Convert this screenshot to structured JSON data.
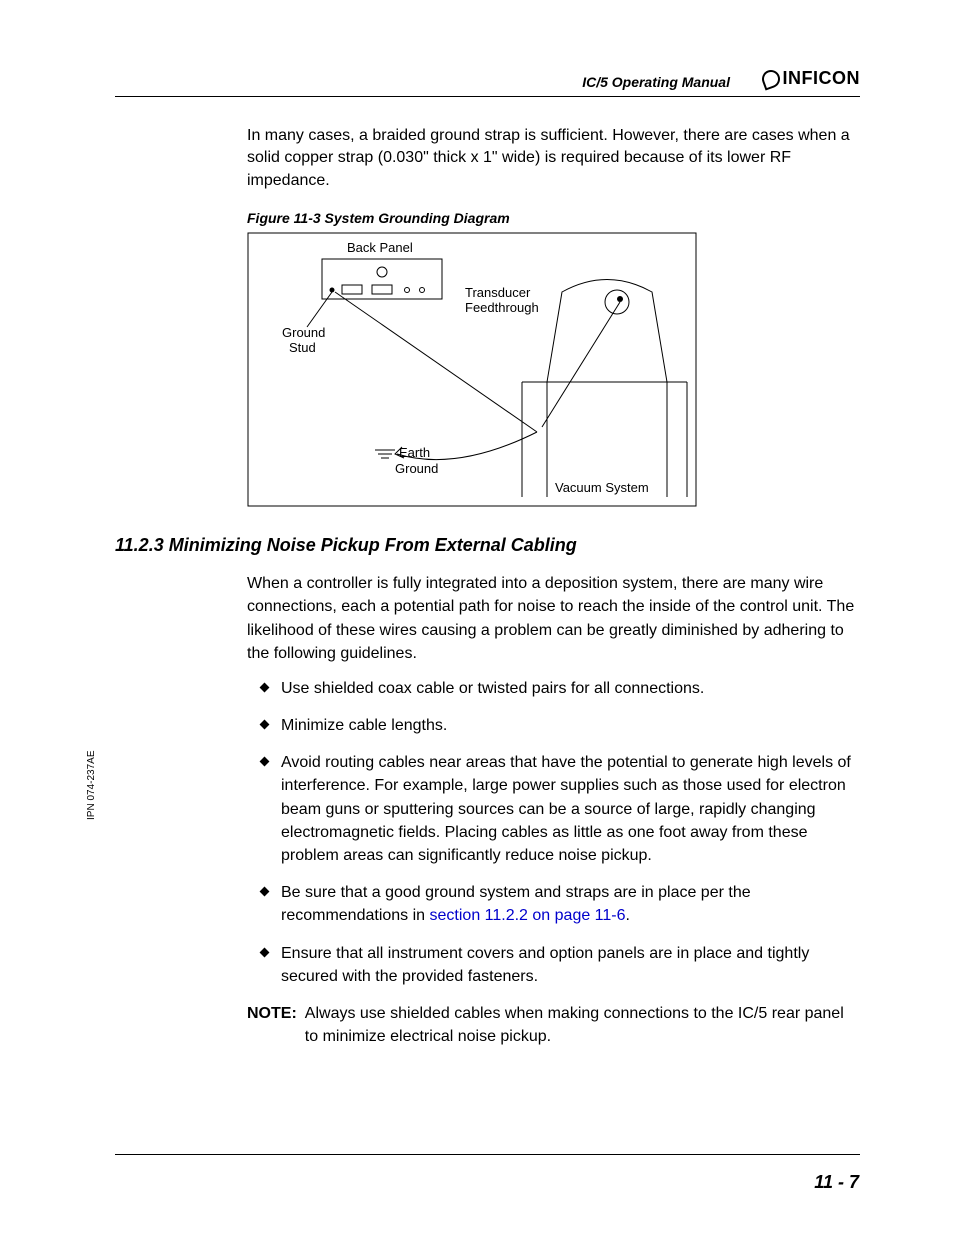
{
  "header": {
    "doc_title": "IC/5 Operating Manual",
    "brand": "INFICON"
  },
  "intro": "In many cases, a braided ground strap is sufficient. However, there are cases when a solid copper strap (0.030\" thick x 1\" wide) is required because of its lower RF impedance.",
  "figure": {
    "caption": "Figure 11-3  System Grounding Diagram",
    "labels": {
      "back_panel": "Back Panel",
      "ground_stud": "Ground",
      "ground_stud2": "Stud",
      "transducer": "Transducer",
      "feedthrough": "Feedthrough",
      "earth": "Earth",
      "ground": "Ground",
      "vacuum": "Vacuum System"
    }
  },
  "section": {
    "number": "11.2.3",
    "title": "Minimizing Noise Pickup From External Cabling",
    "heading_full": "11.2.3  Minimizing Noise Pickup From External Cabling",
    "para": "When a controller is fully integrated into a deposition system, there are many wire connections, each a potential path for noise to reach the inside of the control unit. The likelihood of these wires causing a problem can be greatly diminished by adhering to the following guidelines.",
    "bullets": [
      "Use shielded coax cable or twisted pairs for all connections.",
      "Minimize cable lengths.",
      "Avoid routing cables near areas that have the potential to generate high levels of interference. For example, large power supplies such as those used for electron beam guns or sputtering sources can be a source of large, rapidly changing electromagnetic fields. Placing cables as little as one foot away from these problem areas can significantly reduce noise pickup."
    ],
    "bullet_link_pre": "Be sure that a good ground system and straps are in place per the recommendations in ",
    "bullet_link": "section 11.2.2 on page 11-6",
    "bullet_link_post": ".",
    "bullet_last": "Ensure that all instrument covers and option panels are in place and tightly secured with the provided fasteners.",
    "note_label": "NOTE:",
    "note_text": "Always use shielded cables when making connections to the IC/5 rear panel to minimize electrical noise pickup."
  },
  "page_number": "11 - 7",
  "side_ipn": "IPN 074-237AE"
}
